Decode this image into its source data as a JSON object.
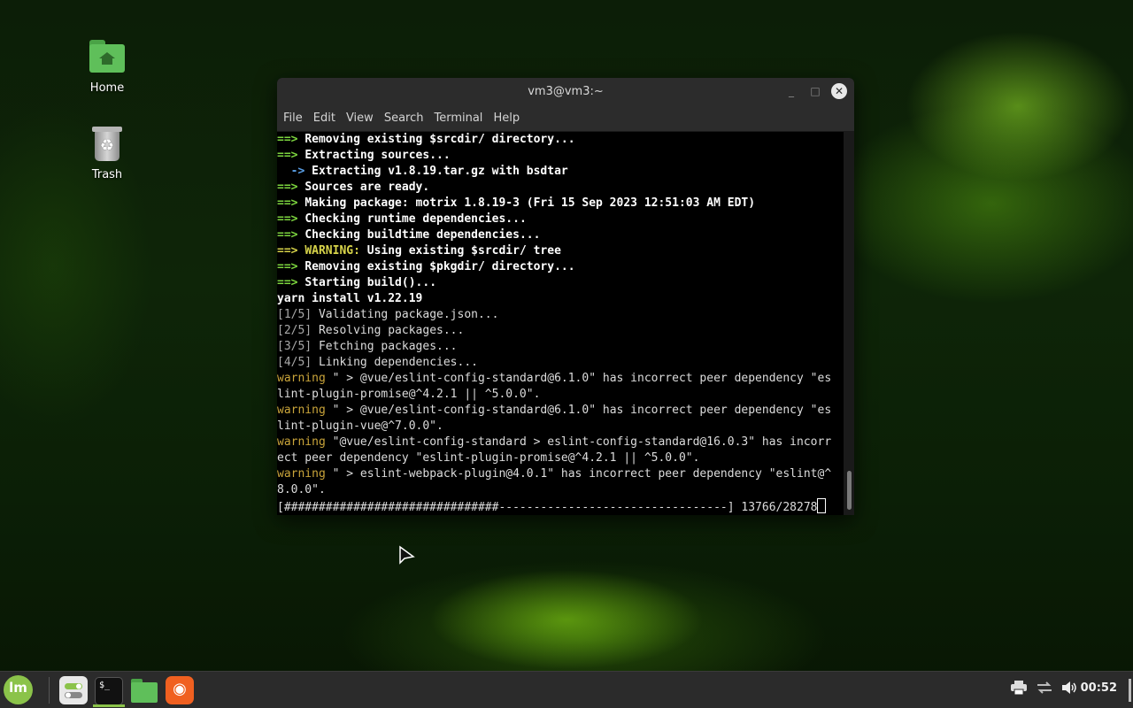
{
  "desktop": {
    "icons": [
      {
        "label": "Home"
      },
      {
        "label": "Trash"
      }
    ]
  },
  "window": {
    "title": "vm3@vm3:~",
    "menu": [
      "File",
      "Edit",
      "View",
      "Search",
      "Terminal",
      "Help"
    ]
  },
  "terminal": {
    "lines": [
      {
        "prefix": "==> ",
        "text": "Removing existing $srcdir/ directory..."
      },
      {
        "prefix": "==> ",
        "text": "Extracting sources..."
      },
      {
        "prefix": "  -> ",
        "text": "Extracting v1.8.19.tar.gz with bsdtar"
      },
      {
        "prefix": "==> ",
        "text": "Sources are ready."
      },
      {
        "prefix": "==> ",
        "text": "Making package: motrix 1.8.19-3 (Fri 15 Sep 2023 12:51:03 AM EDT)"
      },
      {
        "prefix": "==> ",
        "text": "Checking runtime dependencies..."
      },
      {
        "prefix": "==> ",
        "text": "Checking buildtime dependencies..."
      },
      {
        "prefix": "==> ",
        "warn_label": "WARNING:",
        "text": " Using existing $srcdir/ tree"
      },
      {
        "prefix": "==> ",
        "text": "Removing existing $pkgdir/ directory..."
      },
      {
        "prefix": "==> ",
        "text": "Starting build()..."
      },
      {
        "text": "yarn install v1.22.19"
      },
      {
        "step": "[1/5]",
        "text": " Validating package.json..."
      },
      {
        "step": "[2/5]",
        "text": " Resolving packages..."
      },
      {
        "step": "[3/5]",
        "text": " Fetching packages..."
      },
      {
        "step": "[4/5]",
        "text": " Linking dependencies..."
      },
      {
        "warning": "warning",
        "text": " \" > @vue/eslint-config-standard@6.1.0\" has incorrect peer dependency \"es"
      },
      {
        "text": "lint-plugin-promise@^4.2.1 || ^5.0.0\"."
      },
      {
        "warning": "warning",
        "text": " \" > @vue/eslint-config-standard@6.1.0\" has incorrect peer dependency \"es"
      },
      {
        "text": "lint-plugin-vue@^7.0.0\"."
      },
      {
        "warning": "warning",
        "text": " \"@vue/eslint-config-standard > eslint-config-standard@16.0.3\" has incorr"
      },
      {
        "text": "ect peer dependency \"eslint-plugin-promise@^4.2.1 || ^5.0.0\"."
      },
      {
        "warning": "warning",
        "text": " \" > eslint-webpack-plugin@4.0.1\" has incorrect peer dependency \"eslint@^"
      },
      {
        "text": "8.0.0\"."
      },
      {
        "text": "[###############################---------------------------------] 13766/28278"
      }
    ],
    "progress": {
      "current": 13766,
      "total": 28278
    }
  },
  "taskbar": {
    "menu_logo": "lm",
    "apps": [
      {
        "name": "settings",
        "icon": "toggle-icon"
      },
      {
        "name": "terminal",
        "icon": "terminal-icon",
        "glyph": "$_",
        "active": true
      },
      {
        "name": "files",
        "icon": "folder-icon"
      },
      {
        "name": "firefox",
        "icon": "firefox-icon"
      }
    ],
    "clock": "00:52"
  },
  "colors": {
    "accent": "#8bc34a",
    "arrow": "#7dd63f",
    "warning": "#d8d44a",
    "yarn_warning": "#c9a43a"
  }
}
